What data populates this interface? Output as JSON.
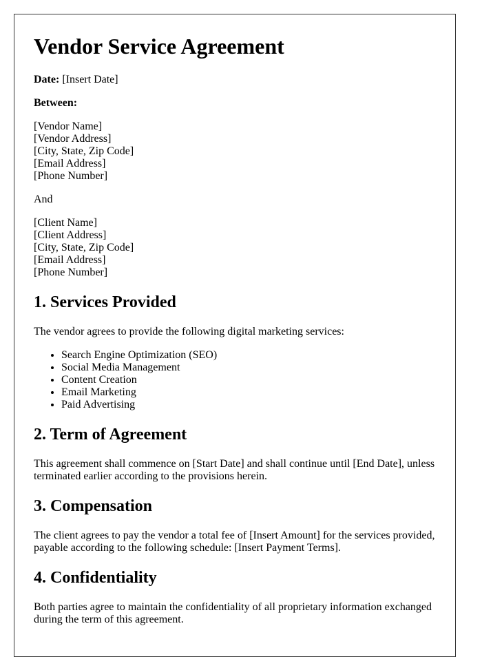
{
  "document": {
    "title": "Vendor Service Agreement",
    "date_label": "Date:",
    "date_value": " [Insert Date]",
    "between_label": "Between:",
    "vendor_block": [
      "[Vendor Name]",
      "[Vendor Address]",
      "[City, State, Zip Code]",
      "[Email Address]",
      "[Phone Number]"
    ],
    "and_label": "And",
    "client_block": [
      "[Client Name]",
      "[Client Address]",
      "[City, State, Zip Code]",
      "[Email Address]",
      "[Phone Number]"
    ],
    "sections": [
      {
        "heading": "1. Services Provided",
        "text": "The vendor agrees to provide the following digital marketing services:",
        "items": [
          "Search Engine Optimization (SEO)",
          "Social Media Management",
          "Content Creation",
          "Email Marketing",
          "Paid Advertising"
        ]
      },
      {
        "heading": "2. Term of Agreement",
        "text": "This agreement shall commence on [Start Date] and shall continue until [End Date], unless terminated earlier according to the provisions herein."
      },
      {
        "heading": "3. Compensation",
        "text": "The client agrees to pay the vendor a total fee of [Insert Amount] for the services provided, payable according to the following schedule: [Insert Payment Terms]."
      },
      {
        "heading": "4. Confidentiality",
        "text": "Both parties agree to maintain the confidentiality of all proprietary information exchanged during the term of this agreement."
      }
    ]
  }
}
